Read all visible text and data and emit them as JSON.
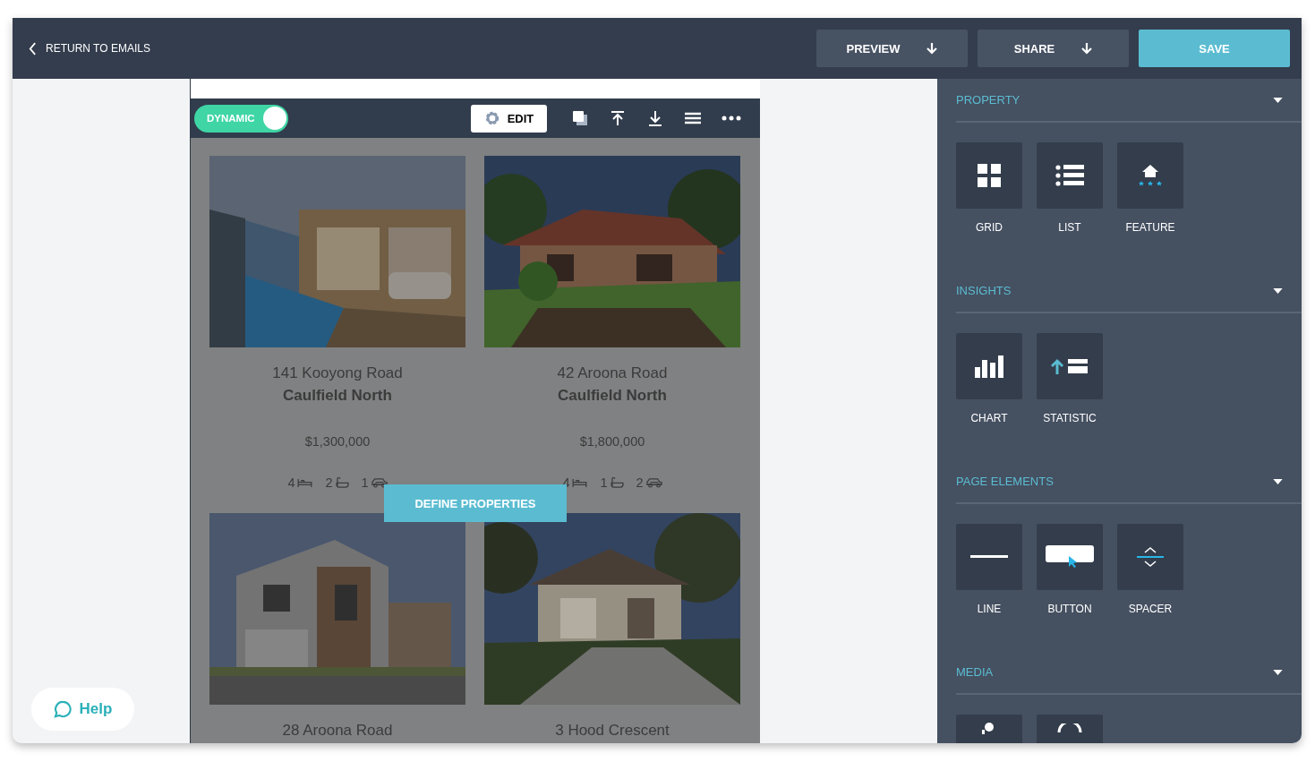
{
  "header": {
    "back_link": "RETURN TO EMAILS",
    "buttons": [
      {
        "label": "PREVIEW",
        "kind": "dropdown"
      },
      {
        "label": "SHARE",
        "kind": "dropdown"
      },
      {
        "label": "SAVE",
        "kind": "primary"
      }
    ]
  },
  "toolbar": {
    "dynamic": {
      "label": "DYNAMIC",
      "on": true
    },
    "edit_button": "EDIT",
    "tools": [
      {
        "kind": "copy"
      },
      {
        "kind": "up"
      },
      {
        "kind": "down"
      },
      {
        "kind": "menu"
      },
      {
        "kind": "more"
      }
    ]
  },
  "properties": [
    {
      "address": "141 Kooyong Road",
      "suburb": "Caulfield North",
      "price": "$1,300,000",
      "features": [
        {
          "kind": "bed",
          "count": "4"
        },
        {
          "kind": "bath",
          "count": "2"
        },
        {
          "kind": "car",
          "count": "1"
        }
      ]
    },
    {
      "address": "42 Aroona Road",
      "suburb": "Caulfield North",
      "price": "$1,800,000",
      "features": [
        {
          "kind": "bed",
          "count": "4"
        },
        {
          "kind": "bath",
          "count": "1"
        },
        {
          "kind": "car",
          "count": "2"
        }
      ]
    },
    {
      "address": "28 Aroona Road"
    },
    {
      "address": "3 Hood Crescent"
    }
  ],
  "define_button": "DEFINE PROPERTIES",
  "help_button": "Help",
  "sections": [
    {
      "title": "PROPERTY",
      "tiles": [
        {
          "kind": "grid",
          "label": "GRID"
        },
        {
          "kind": "list",
          "label": "LIST"
        },
        {
          "kind": "feature",
          "label": "FEATURE"
        }
      ]
    },
    {
      "title": "INSIGHTS",
      "tiles": [
        {
          "kind": "chart",
          "label": "CHART"
        },
        {
          "kind": "statistic",
          "label": "STATISTIC"
        }
      ]
    },
    {
      "title": "PAGE ELEMENTS",
      "tiles": [
        {
          "kind": "line",
          "label": "LINE"
        },
        {
          "kind": "button",
          "label": "BUTTON"
        },
        {
          "kind": "spacer",
          "label": "SPACER"
        }
      ]
    },
    {
      "title": "MEDIA",
      "tiles": [
        {
          "kind": "pin"
        },
        {
          "kind": "ring"
        }
      ]
    }
  ]
}
